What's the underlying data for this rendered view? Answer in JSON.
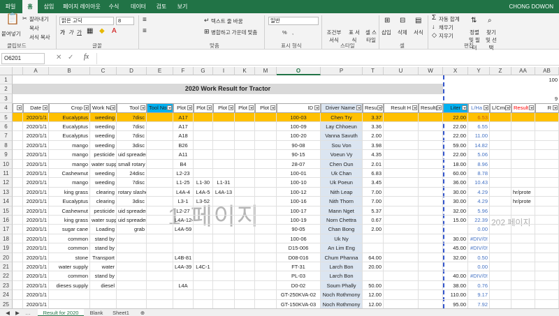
{
  "ribbon_tabs": [
    "파일",
    "홈",
    "삽입",
    "페이지 레이아웃",
    "수식",
    "데이터",
    "검토",
    "보기"
  ],
  "user": "CHONG DOWON",
  "ribbon": {
    "paste": "붙여넣기",
    "cut": "잘라내기",
    "copy": "복사",
    "format_painter": "서식 복사",
    "font_name": "맑은 고딕",
    "font_size": "8",
    "wrap_text": "텍스트 줄 바꿈",
    "merge_center": "병합하고 가운데 맞춤",
    "number_format": "일반",
    "conditional": "조건부 서식",
    "table_format": "표 서식",
    "cell_style": "셀 스타일",
    "insert": "삽입",
    "delete": "삭제",
    "format": "서식",
    "autosum": "자동 합계",
    "fill": "채우기",
    "clear": "지우기",
    "sort_filter": "정렬 및 필터",
    "find_select": "찾기 및 선택",
    "groups": [
      "클립보드",
      "글꼴",
      "맞춤",
      "표시 형식",
      "스타일",
      "셀",
      "편집"
    ]
  },
  "namebox": "O6201",
  "fx": "fx",
  "columns": [
    "A",
    "B",
    "C",
    "D",
    "E",
    "F",
    "G",
    "I",
    "K",
    "M",
    "O",
    "P",
    "T",
    "U",
    "W",
    "X",
    "Y",
    "Z",
    "AA",
    "AB"
  ],
  "selected_column": "O",
  "row_numbers": [
    "1",
    "2",
    "3",
    "4",
    "5",
    "6",
    "7",
    "8",
    "9",
    "10",
    "11",
    "12",
    "13",
    "14",
    "15",
    "16",
    "17",
    "18",
    "19",
    "20",
    "21",
    "22",
    "23",
    "24",
    "25"
  ],
  "corner_value_r1": "100",
  "corner_value_r3": "9",
  "title": "2020 Work Result for Tractor",
  "headers": [
    "",
    "Date",
    "Crop",
    "Work Nan",
    "Tool",
    "Tool No.",
    "Plot",
    "Plot",
    "Plot",
    "Plot",
    "Plot",
    "ID",
    "Driver Name",
    "Result(h",
    "Result H",
    "Result(h",
    "Liter",
    "L/Ha",
    "L/Cm(Tr",
    "Result",
    "R"
  ],
  "rows": [
    [
      "",
      "2020/1/1",
      "Eucalyptus",
      "weeding",
      "7disc",
      "",
      "A17",
      "",
      "",
      "",
      "",
      "100-03",
      "Chen Try",
      "3.37",
      "",
      "",
      "22.00",
      "6.53",
      "",
      "",
      ""
    ],
    [
      "",
      "2020/1/1",
      "Eucalyptus",
      "weeding",
      "7disc",
      "",
      "A17",
      "",
      "",
      "",
      "",
      "100-09",
      "Lay Chhoeun",
      "3.36",
      "",
      "",
      "22.00",
      "6.55",
      "",
      "",
      ""
    ],
    [
      "",
      "2020/1/1",
      "Eucalyptus",
      "weeding",
      "7disc",
      "",
      "A18",
      "",
      "",
      "",
      "",
      "100-20",
      "Vanna Savuth",
      "2.00",
      "",
      "",
      "22.00",
      "11.00",
      "",
      "",
      ""
    ],
    [
      "",
      "2020/1/1",
      "mango",
      "weeding",
      "3disc",
      "",
      "B26",
      "",
      "",
      "",
      "",
      "90-08",
      "Sou Von",
      "3.98",
      "",
      "",
      "59.00",
      "14.82",
      "",
      "",
      ""
    ],
    [
      "",
      "2020/1/1",
      "mango",
      "pesticide",
      "uid spreader",
      "",
      "A11",
      "",
      "",
      "",
      "",
      "90-15",
      "Voeun Vy",
      "4.35",
      "",
      "",
      "22.00",
      "5.06",
      "",
      "",
      ""
    ],
    [
      "",
      "2020/1/1",
      "mango",
      "water supply",
      "small rotary",
      "",
      "B4",
      "",
      "",
      "",
      "",
      "28-07",
      "Chen Oun",
      "2.01",
      "",
      "",
      "18.00",
      "8.96",
      "",
      "",
      ""
    ],
    [
      "",
      "2020/1/1",
      "Cashewnut",
      "weeding",
      "24disc",
      "",
      "L2-23",
      "",
      "",
      "",
      "",
      "100-01",
      "Uk Chan",
      "6.83",
      "",
      "",
      "60.00",
      "8.78",
      "",
      "",
      ""
    ],
    [
      "",
      "2020/1/1",
      "mango",
      "weeding",
      "7disc",
      "",
      "L1-25",
      "L1-30",
      "L1-31",
      "",
      "",
      "100-10",
      "Uk Poeun",
      "3.45",
      "",
      "",
      "36.00",
      "10.43",
      "",
      "",
      ""
    ],
    [
      "",
      "2020/1/1",
      "king grass",
      "clearing",
      "rotary slashe",
      "",
      "L4A-4",
      "L4A-5",
      "L4A-13",
      "",
      "",
      "100-12",
      "Nith Leap",
      "7.00",
      "",
      "",
      "30.00",
      "4.29",
      "",
      "hr/prote",
      ""
    ],
    [
      "",
      "2020/1/1",
      "Eucalyptus",
      "clearing",
      "3disc",
      "",
      "L3-1",
      "L3-52",
      "",
      "",
      "",
      "100-16",
      "Nith Thorn",
      "7.00",
      "",
      "",
      "30.00",
      "4.29",
      "",
      "hr/prote",
      ""
    ],
    [
      "",
      "2020/1/1",
      "Cashewnut",
      "pesticide",
      "uid spreader",
      "",
      "L2-27",
      "",
      "",
      "",
      "",
      "100-17",
      "Mann Nget",
      "5.37",
      "",
      "",
      "32.00",
      "5.96",
      "",
      "",
      ""
    ],
    [
      "",
      "2020/1/1",
      "king grass",
      "water supply",
      "uid spreader",
      "",
      "L4A-12",
      "",
      "",
      "",
      "",
      "100-19",
      "Norn Chettra",
      "0.67",
      "",
      "",
      "15.00",
      "22.39",
      "",
      "",
      ""
    ],
    [
      "",
      "2020/1/1",
      "sugar cane",
      "Loading",
      "grab",
      "",
      "L4A-59",
      "",
      "",
      "",
      "",
      "90-05",
      "Chan Bong",
      "2.00",
      "",
      "",
      "",
      "0.00",
      "",
      "",
      ""
    ],
    [
      "",
      "2020/1/1",
      "common",
      "stand by",
      "",
      "",
      "",
      "",
      "",
      "",
      "",
      "100-06",
      "Uk Ny",
      "",
      "",
      "",
      "30.00",
      "#DIV/0!",
      "",
      "",
      ""
    ],
    [
      "",
      "2020/1/1",
      "common",
      "stand by",
      "",
      "",
      "",
      "",
      "",
      "",
      "",
      "D15-006",
      "An Lim Eng",
      "",
      "",
      "",
      "45.00",
      "#DIV/0!",
      "",
      "",
      ""
    ],
    [
      "",
      "2020/1/1",
      "stone",
      "Transport",
      "",
      "",
      "L4B-81",
      "",
      "",
      "",
      "",
      "D08-016",
      "Chum Phanna",
      "64.00",
      "",
      "",
      "32.00",
      "0.50",
      "",
      "",
      ""
    ],
    [
      "",
      "2020/1/1",
      "water supply",
      "water",
      "",
      "",
      "L4A-39",
      "L4C-1",
      "",
      "",
      "",
      "FT-31",
      "Larch Bon",
      "20.00",
      "",
      "",
      "",
      "0.00",
      "",
      "",
      ""
    ],
    [
      "",
      "2020/1/1",
      "common",
      "stand by",
      "",
      "",
      "",
      "",
      "",
      "",
      "",
      "PL-03",
      "Larch Bon",
      "",
      "",
      "",
      "40.00",
      "#DIV/0!",
      "",
      "",
      ""
    ],
    [
      "",
      "2020/1/1",
      "dieses supply",
      "diesel",
      "",
      "",
      "L4A",
      "",
      "",
      "",
      "",
      "D0-02",
      "Soum Phally",
      "50.00",
      "",
      "",
      "38.00",
      "0.76",
      "",
      "",
      ""
    ],
    [
      "",
      "2020/1/1",
      "",
      "",
      "",
      "",
      "",
      "",
      "",
      "",
      "",
      "GT-250KVA-02",
      "Noch Rothmony",
      "12.00",
      "",
      "",
      "110.00",
      "9.17",
      "",
      "",
      ""
    ],
    [
      "",
      "2020/1/1",
      "",
      "",
      "",
      "",
      "",
      "",
      "",
      "",
      "",
      "GT-150KVA-03",
      "Noch Rothmony",
      "12.00",
      "",
      "",
      "95.00",
      "7.92",
      "",
      "",
      ""
    ]
  ],
  "watermark": "1 페이지",
  "watermark2": "202 페이지",
  "sheets": [
    "Result for 2020",
    "Blank",
    "Sheet1"
  ],
  "colors": {
    "excel_green": "#217346",
    "highlight_row": "#ffc000",
    "blue_text": "#4472c4",
    "header_blue": "#00b0f0",
    "red_header": "#ff0000",
    "page_break": "#3355cc"
  }
}
